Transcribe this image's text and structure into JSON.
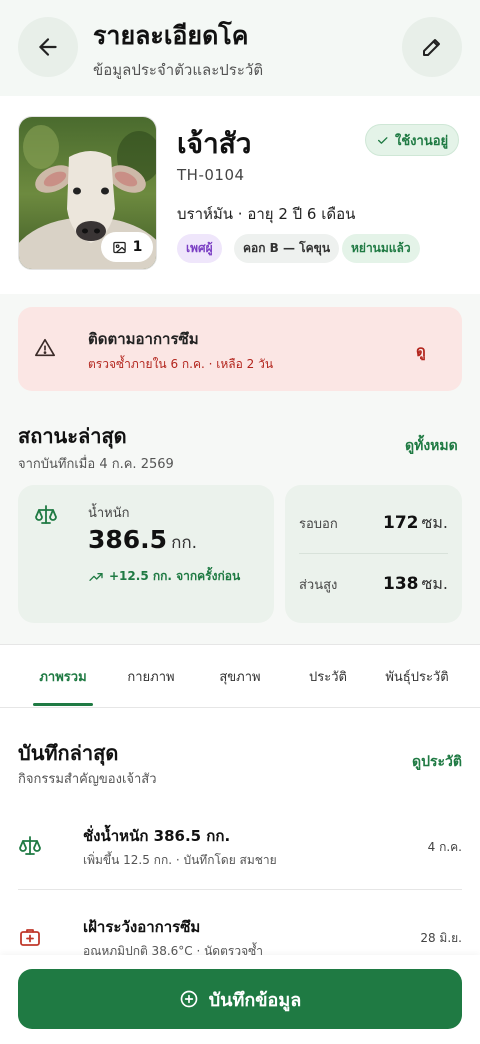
{
  "header": {
    "title": "รายละเอียดโค",
    "subtitle": "ข้อมูลประจำตัวและประวัติ",
    "back_icon": "arrow-left-icon",
    "edit_icon": "pencil-icon"
  },
  "profile": {
    "name": "เจ้าสัว",
    "tag_id": "TH-0104",
    "breed_age": "บราห์มัน · อายุ 2 ปี 6 เดือน",
    "status": "ใช้งานอยู่",
    "photo_count": "1",
    "chips": {
      "sex": "เพศผู้",
      "pen": "คอก B — โคขุน",
      "wean": "หย่านมแล้ว"
    }
  },
  "alert": {
    "title": "ติดตามอาการซึม",
    "subtitle": "ตรวจซ้ำภายใน 6 ก.ค. · เหลือ 2 วัน",
    "link": "ดู"
  },
  "latest_status": {
    "title": "สถานะล่าสุด",
    "subtitle": "จากบันทึกเมื่อ 4 ก.ค. 2569",
    "link": "ดูทั้งหมด",
    "weight": {
      "label": "น้ำหนัก",
      "value": "386.5",
      "unit": "กก.",
      "delta": "+12.5 กก. จากครั้งก่อน"
    },
    "girth": {
      "label": "รอบอก",
      "value": "172",
      "unit": "ซม."
    },
    "height": {
      "label": "ส่วนสูง",
      "value": "138",
      "unit": "ซม."
    }
  },
  "tabs": [
    {
      "label": "ภาพรวม"
    },
    {
      "label": "กายภาพ"
    },
    {
      "label": "สุขภาพ"
    },
    {
      "label": "ประวัติ"
    },
    {
      "label": "พันธุ์ประวัติ"
    }
  ],
  "recent": {
    "title": "บันทึกล่าสุด",
    "subtitle": "กิจกรรมสำคัญของเจ้าสัว",
    "link": "ดูประวัติ",
    "items": [
      {
        "title": "ชั่งน้ำหนัก 386.5 กก.",
        "subtitle": "เพิ่มขึ้น 12.5 กก. · บันทึกโดย สมชาย",
        "date": "4 ก.ค.",
        "icon": "scale-icon"
      },
      {
        "title": "เฝ้าระวังอาการซึม",
        "subtitle": "อุณหภูมิปกติ 38.6°C · นัดตรวจซ้ำ",
        "date": "28 มิ.ย.",
        "icon": "medical-kit-icon"
      }
    ]
  },
  "action": {
    "label": "บันทึกข้อมูล"
  },
  "colors": {
    "primary": "#1f7a43",
    "alert_bg": "#fbe6e4",
    "alert_text": "#b3261e",
    "card_bg": "#ebf2ec"
  }
}
